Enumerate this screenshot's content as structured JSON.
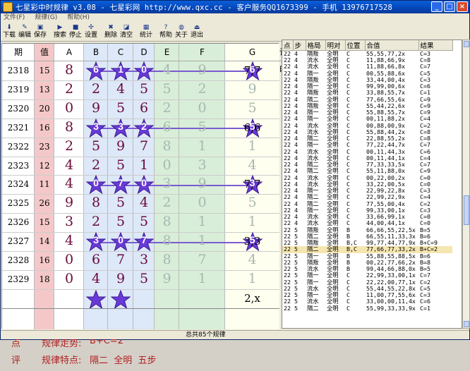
{
  "window": {
    "title": "七星彩中时规律 v3.08 - 七星彩网 http://www.qxc.cc - 客户服务QQ1673399 - 手机 13976717528",
    "controls": [
      "_",
      "□",
      "×"
    ]
  },
  "menu": [
    "文件(F)",
    "规律(G)",
    "帮助(H)"
  ],
  "toolbar": [
    {
      "label": "下载",
      "icon": "download-icon"
    },
    {
      "label": "编辑",
      "icon": "edit-icon"
    },
    {
      "label": "保存",
      "icon": "save-icon"
    },
    {
      "label": "搜索",
      "icon": "search-icon"
    },
    {
      "label": "停止",
      "icon": "stop-icon"
    },
    {
      "label": "设置",
      "icon": "settings-icon"
    },
    {
      "label": "删除",
      "icon": "delete-icon"
    },
    {
      "label": "清空",
      "icon": "clear-icon"
    },
    {
      "label": "统计",
      "icon": "stats-icon"
    },
    {
      "label": "帮助",
      "icon": "help-icon"
    },
    {
      "label": "关于",
      "icon": "about-icon"
    },
    {
      "label": "退出",
      "icon": "exit-icon"
    }
  ],
  "grid": {
    "headers": [
      "期",
      "值",
      "A",
      "B",
      "C",
      "D",
      "E",
      "F",
      "G",
      "说明"
    ],
    "rows": [
      {
        "period": "2318",
        "value": "15",
        "digits": [
          "8",
          "6",
          "1",
          "0",
          "4",
          "9",
          "6"
        ],
        "stars": [
          1,
          2,
          3,
          6
        ],
        "note": "7,7"
      },
      {
        "period": "2319",
        "value": "13",
        "digits": [
          "2",
          "2",
          "4",
          "5",
          "5",
          "2",
          "9"
        ],
        "stars": [],
        "note": ""
      },
      {
        "period": "2320",
        "value": "20",
        "digits": [
          "0",
          "9",
          "5",
          "6",
          "2",
          "0",
          "5"
        ],
        "stars": [],
        "note": ""
      },
      {
        "period": "2321",
        "value": "16",
        "digits": [
          "8",
          "3",
          "3",
          "2",
          "6",
          "5",
          "5"
        ],
        "stars": [
          1,
          2,
          3,
          6
        ],
        "note": "6,6"
      },
      {
        "period": "2322",
        "value": "23",
        "digits": [
          "2",
          "5",
          "9",
          "7",
          "8",
          "1",
          "1"
        ],
        "stars": [],
        "note": ""
      },
      {
        "period": "2323",
        "value": "12",
        "digits": [
          "4",
          "2",
          "5",
          "1",
          "0",
          "3",
          "4"
        ],
        "stars": [],
        "note": ""
      },
      {
        "period": "2324",
        "value": "11",
        "digits": [
          "4",
          "0",
          "7",
          "0",
          "3",
          "9",
          "3"
        ],
        "stars": [
          1,
          2,
          3,
          6
        ],
        "note": "7,7"
      },
      {
        "period": "2325",
        "value": "26",
        "digits": [
          "9",
          "8",
          "5",
          "4",
          "2",
          "0",
          "5"
        ],
        "stars": [],
        "note": ""
      },
      {
        "period": "2326",
        "value": "15",
        "digits": [
          "3",
          "2",
          "5",
          "5",
          "8",
          "1",
          "1"
        ],
        "stars": [],
        "note": ""
      },
      {
        "period": "2327",
        "value": "14",
        "digits": [
          "4",
          "3",
          "0",
          "7",
          "8",
          "1",
          "5"
        ],
        "stars": [
          1,
          2,
          3,
          6
        ],
        "note": "3,3"
      },
      {
        "period": "2328",
        "value": "16",
        "digits": [
          "0",
          "6",
          "7",
          "3",
          "8",
          "7",
          "4"
        ],
        "stars": [],
        "note": ""
      },
      {
        "period": "2329",
        "value": "18",
        "digits": [
          "0",
          "4",
          "9",
          "5",
          "9",
          "1",
          "1"
        ],
        "stars": [],
        "note": ""
      }
    ],
    "forecast_note": "2,x",
    "forecast_stars": [
      1,
      2
    ]
  },
  "footer": {
    "label_top": "点",
    "label_bottom": "评",
    "line1_prefix": "规律走势:",
    "line1_value": "B+C=2",
    "line2_prefix": "规律特点:",
    "line2_value": "隔二  全明  五步"
  },
  "results": {
    "headers": [
      "点",
      "步",
      "格局",
      "明对",
      "位置",
      "合值",
      "结果"
    ],
    "rows": [
      [
        "22",
        "4",
        "隔叛",
        "全明",
        "C",
        "55,55,77,2x",
        "C=3"
      ],
      [
        "22",
        "4",
        "流水",
        "全明",
        "C",
        "11,88,66,9x",
        "C=8"
      ],
      [
        "22",
        "4",
        "流水",
        "全明",
        "C",
        "11,88,66,8x",
        "C=7"
      ],
      [
        "22",
        "4",
        "隔一",
        "全明",
        "C",
        "00,55,88,6x",
        "C=5"
      ],
      [
        "22",
        "4",
        "隔叛",
        "全明",
        "C",
        "33,44,00,4x",
        "C=3"
      ],
      [
        "22",
        "4",
        "隔一",
        "全明",
        "C",
        "99,99,00,6x",
        "C=6"
      ],
      [
        "22",
        "4",
        "隔叛",
        "全明",
        "C",
        "33,88,55,7x",
        "C=1"
      ],
      [
        "22",
        "4",
        "隔二",
        "全明",
        "C",
        "77,66,55,6x",
        "C=9"
      ],
      [
        "22",
        "4",
        "隔叛",
        "全明",
        "C",
        "55,44,22,6x",
        "C=9"
      ],
      [
        "22",
        "4",
        "隔一",
        "全明",
        "C",
        "55,88,55,7x",
        "C=9"
      ],
      [
        "22",
        "4",
        "隔一",
        "全明",
        "C",
        "00,11,88,2x",
        "C=4"
      ],
      [
        "22",
        "4",
        "流水",
        "全明",
        "C",
        "00,88,00,9x",
        "C=2"
      ],
      [
        "22",
        "4",
        "流水",
        "全明",
        "C",
        "55,88,44,2x",
        "C=8"
      ],
      [
        "22",
        "4",
        "隔二",
        "全明",
        "C",
        "22,88,55,2x",
        "C=8"
      ],
      [
        "22",
        "4",
        "隔一",
        "全明",
        "C",
        "77,22,44,7x",
        "C=7"
      ],
      [
        "22",
        "4",
        "流水",
        "全明",
        "C",
        "00,11,44,3x",
        "C=6"
      ],
      [
        "22",
        "4",
        "流水",
        "全明",
        "C",
        "00,11,44,1x",
        "C=4"
      ],
      [
        "22",
        "4",
        "隔二",
        "全明",
        "C",
        "77,33,33,5x",
        "C=7"
      ],
      [
        "22",
        "4",
        "隔二",
        "全明",
        "C",
        "55,11,88,0x",
        "C=9"
      ],
      [
        "22",
        "4",
        "流水",
        "全明",
        "C",
        "00,22,00,2x",
        "C=0"
      ],
      [
        "22",
        "4",
        "流水",
        "全明",
        "C",
        "33,22,00,5x",
        "C=0"
      ],
      [
        "22",
        "4",
        "隔一",
        "全明",
        "C",
        "22,99,22,8x",
        "C=3"
      ],
      [
        "22",
        "4",
        "隔二",
        "全明",
        "C",
        "22,99,22,9x",
        "C=4"
      ],
      [
        "22",
        "4",
        "隔二",
        "全明",
        "C",
        "77,55,00,4x",
        "C=2"
      ],
      [
        "22",
        "4",
        "隔一",
        "全明",
        "C",
        "99,33,00,1x",
        "C=3"
      ],
      [
        "22",
        "4",
        "流水",
        "全明",
        "C",
        "33,66,99,1x",
        "C=0"
      ],
      [
        "22",
        "4",
        "流水",
        "全明",
        "C",
        "44,00,44,1x",
        "C=0"
      ],
      [
        "22",
        "5",
        "隔叛",
        "全明",
        "B",
        "66,66,55,22,5x",
        "B=5"
      ],
      [
        "22",
        "5",
        "隔二",
        "全明",
        "B",
        "66,55,11,33,3x",
        "B=6"
      ],
      [
        "22",
        "5",
        "隔叛",
        "全明",
        "B,C",
        "99,77,44,77,9x",
        "B+C=9"
      ],
      [
        "22",
        "5",
        "隔二",
        "全明",
        "B,C",
        "77,66,77,33,2x",
        "B+C=2"
      ],
      [
        "22",
        "5",
        "隔一",
        "全明",
        "B",
        "55,88,55,88,5x",
        "B=6"
      ],
      [
        "22",
        "5",
        "隔叛",
        "全明",
        "B",
        "00,22,77,66,2x",
        "B=8"
      ],
      [
        "22",
        "5",
        "流水",
        "全明",
        "B",
        "99,44,66,88,0x",
        "B=5"
      ],
      [
        "22",
        "5",
        "隔一",
        "全明",
        "C",
        "22,99,33,00,1x",
        "C=7"
      ],
      [
        "22",
        "5",
        "隔一",
        "全明",
        "C",
        "22,22,00,77,1x",
        "C=2"
      ],
      [
        "22",
        "5",
        "流水",
        "全明",
        "C",
        "55,44,55,22,8x",
        "C=5"
      ],
      [
        "22",
        "5",
        "隔一",
        "全明",
        "C",
        "11,00,77,55,6x",
        "C=3"
      ],
      [
        "22",
        "5",
        "流水",
        "全明",
        "C",
        "33,00,00,11,4x",
        "C=6"
      ],
      [
        "22",
        "5",
        "隔二",
        "全明",
        "C",
        "55,99,33,33,9x",
        "C=1"
      ]
    ],
    "selected_index": 30
  },
  "status": "总共85个规律",
  "colors": {
    "star": "#6a3ad8",
    "digit": "#6a0a3a",
    "ghost": "#a8b8b0",
    "footer_text": "#b02020"
  }
}
